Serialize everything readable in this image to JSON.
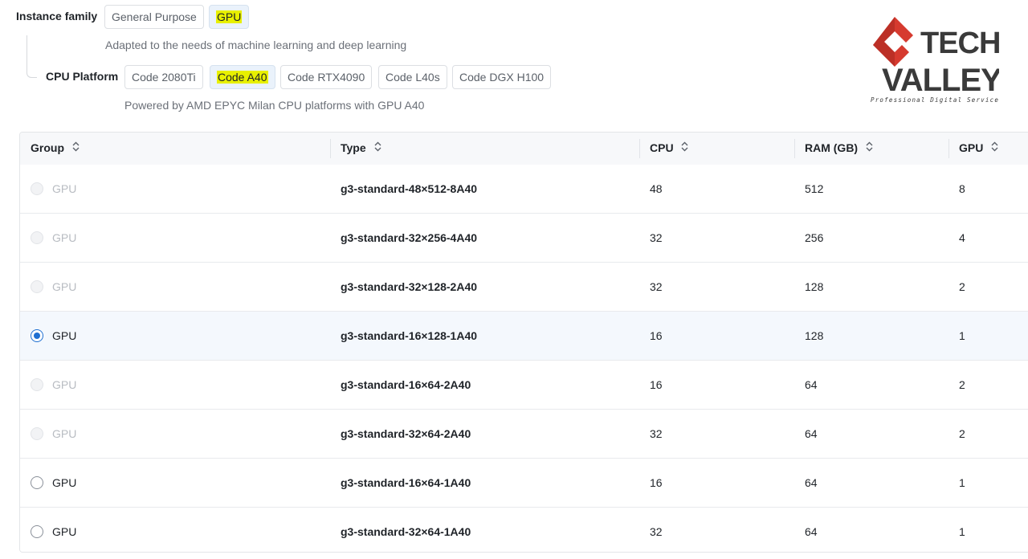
{
  "instance_family": {
    "label": "Instance family",
    "options": [
      "General Purpose",
      "GPU"
    ],
    "selected": "GPU",
    "description": "Adapted to the needs of machine learning and deep learning"
  },
  "cpu_platform": {
    "label": "CPU Platform",
    "options": [
      "Code 2080Ti",
      "Code A40",
      "Code RTX4090",
      "Code L40s",
      "Code DGX H100"
    ],
    "selected": "Code A40",
    "description": "Powered by AMD EPYC Milan CPU platforms with GPU A40"
  },
  "logo": {
    "line1": "TECH",
    "line2": "VALLEY",
    "tagline": "Professional Digital Service"
  },
  "table": {
    "columns": [
      "Group",
      "Type",
      "CPU",
      "RAM (GB)",
      "GPU"
    ],
    "rows": [
      {
        "group": "GPU",
        "type": "g3-standard-48×512-8A40",
        "cpu": "48",
        "ram": "512",
        "gpu": "8",
        "state": "disabled"
      },
      {
        "group": "GPU",
        "type": "g3-standard-32×256-4A40",
        "cpu": "32",
        "ram": "256",
        "gpu": "4",
        "state": "disabled"
      },
      {
        "group": "GPU",
        "type": "g3-standard-32×128-2A40",
        "cpu": "32",
        "ram": "128",
        "gpu": "2",
        "state": "disabled"
      },
      {
        "group": "GPU",
        "type": "g3-standard-16×128-1A40",
        "cpu": "16",
        "ram": "128",
        "gpu": "1",
        "state": "selected"
      },
      {
        "group": "GPU",
        "type": "g3-standard-16×64-2A40",
        "cpu": "16",
        "ram": "64",
        "gpu": "2",
        "state": "disabled"
      },
      {
        "group": "GPU",
        "type": "g3-standard-32×64-2A40",
        "cpu": "32",
        "ram": "64",
        "gpu": "2",
        "state": "disabled"
      },
      {
        "group": "GPU",
        "type": "g3-standard-16×64-1A40",
        "cpu": "16",
        "ram": "64",
        "gpu": "1",
        "state": "available"
      },
      {
        "group": "GPU",
        "type": "g3-standard-32×64-1A40",
        "cpu": "32",
        "ram": "64",
        "gpu": "1",
        "state": "available"
      }
    ]
  },
  "colors": {
    "accent": "#1f6fd1",
    "highlight": "#e8f000",
    "logo_red": "#d63a2f",
    "logo_dark": "#3a3a3a"
  }
}
